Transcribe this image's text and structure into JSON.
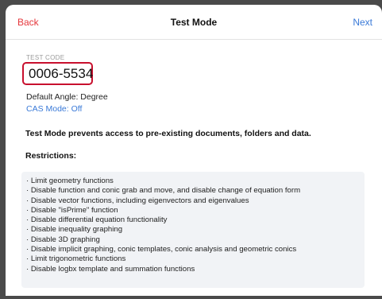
{
  "navbar": {
    "back_label": "Back",
    "title": "Test Mode",
    "next_label": "Next"
  },
  "test_code": {
    "label": "TEST CODE",
    "value": "0006-5534"
  },
  "settings": {
    "angle": "Default Angle: Degree",
    "cas": "CAS Mode: Off"
  },
  "warning": "Test Mode prevents access to pre-existing documents, folders and data.",
  "restrictions": {
    "heading": "Restrictions:",
    "items": [
      "· Limit geometry functions",
      "· Disable function and conic grab and move, and disable change of equation form",
      "· Disable vector functions, including eigenvectors and eigenvalues",
      "· Disable \"isPrime\" function",
      "· Disable differential equation functionality",
      "· Disable inequality graphing",
      "· Disable 3D graphing",
      "· Disable implicit graphing, conic templates, conic analysis and geometric conics",
      "· Limit trigonometric functions",
      "· Disable logbx template and summation functions"
    ]
  },
  "colors": {
    "accent_red": "#e5373c",
    "link_blue": "#3a7ad8",
    "highlight_red": "#c8102e"
  }
}
